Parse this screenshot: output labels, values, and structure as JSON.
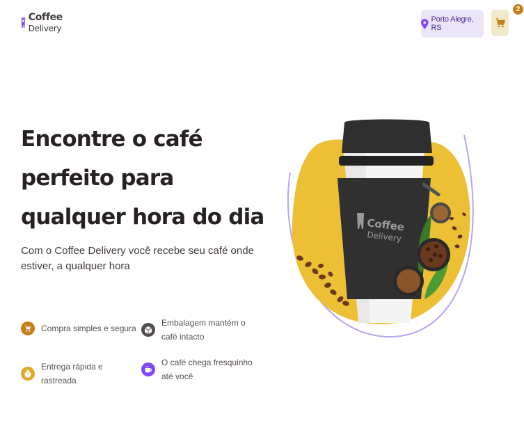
{
  "header": {
    "logo_line1": "Coffee",
    "logo_line2": "Delivery",
    "location": "Porto Alegre, RS",
    "cart_count": "2",
    "location_icon": "map-pin-icon",
    "cart_icon": "shopping-cart-icon"
  },
  "hero": {
    "title": "Encontre o café perfeito para qualquer hora do dia",
    "subtitle": "Com o Coffee Delivery você recebe seu café onde estiver, a qualquer hora",
    "cup_logo_line1": "Coffee",
    "cup_logo_line2": "Delivery"
  },
  "features": [
    {
      "label": "Compra simples e segura",
      "icon": "shopping-cart-icon",
      "color": "#c47f17"
    },
    {
      "label": "Embalagem mantém o café intacto",
      "icon": "package-icon",
      "color": "#574f4d"
    },
    {
      "label": "Entrega rápida e rastreada",
      "icon": "timer-icon",
      "color": "#dbac2c"
    },
    {
      "label": "O café chega fresquinho até você",
      "icon": "coffee-icon",
      "color": "#8047f8"
    }
  ],
  "colors": {
    "brand_purple": "#8047f8",
    "yellow": "#dbac2c",
    "yellow_dark": "#c47f17",
    "purple_light": "#ebe5f9",
    "yellow_light": "#f1e9c9"
  }
}
